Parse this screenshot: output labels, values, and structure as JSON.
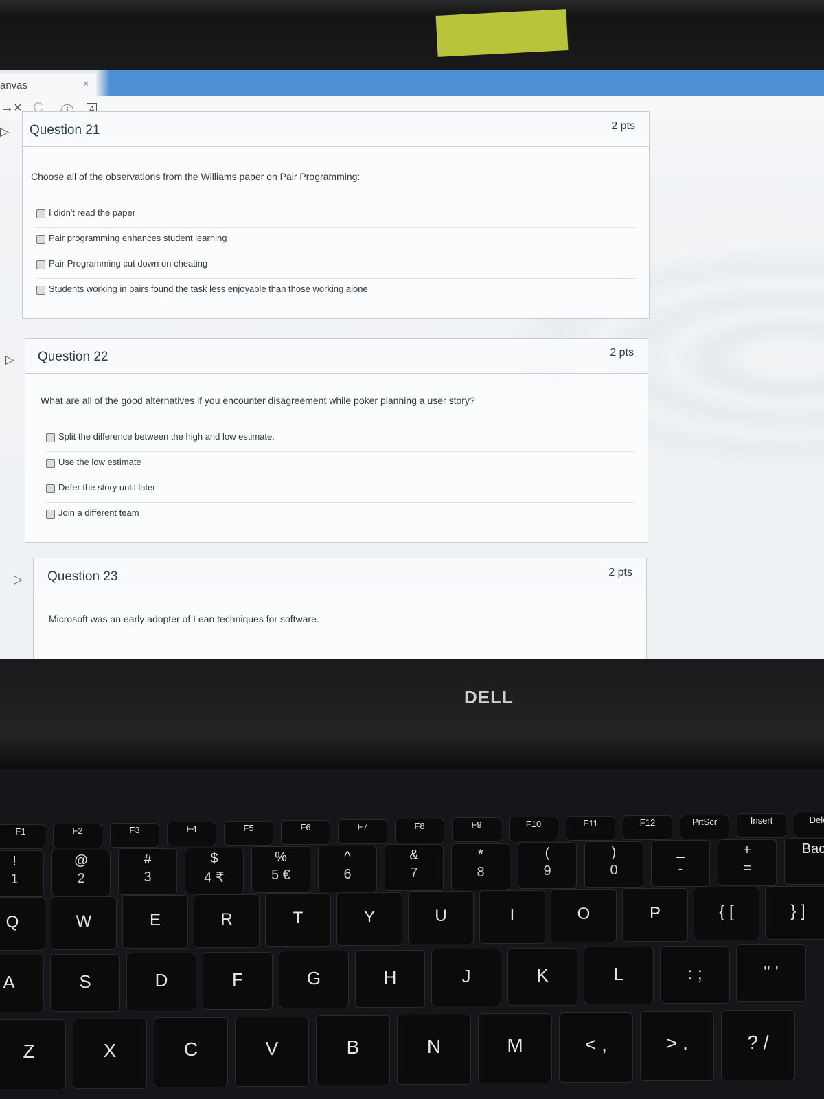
{
  "browser": {
    "tab_title": "anvas",
    "tab_close": "×",
    "nav": {
      "back_icon": "arrow-left",
      "stop_icon": "×",
      "reload_icon": "C",
      "info_icon": "ⓘ",
      "lock_icon": "A"
    }
  },
  "questions": [
    {
      "title": "Question 21",
      "points": "2 pts",
      "text": "Choose all of the observations from the Williams paper on Pair Programming:",
      "answers": [
        "I didn't read the paper",
        "Pair programming enhances student learning",
        "Pair Programming cut down on cheating",
        "Students working in pairs found the task less enjoyable than those working alone"
      ]
    },
    {
      "title": "Question 22",
      "points": "2 pts",
      "text": "What are all of the good alternatives if you encounter disagreement while poker planning a user story?",
      "answers": [
        "Split the difference between the high and low estimate.",
        "Use the low estimate",
        "Defer the story until later",
        "Join a different team"
      ]
    },
    {
      "title": "Question 23",
      "points": "2 pts",
      "text": "Microsoft was an early adopter of Lean techniques for software.",
      "answers": []
    }
  ],
  "laptop": {
    "brand": "DELL"
  },
  "keyboard": {
    "fn_row": [
      "F1",
      "F2",
      "F3",
      "F4",
      "F5",
      "F6",
      "F7",
      "F8",
      "F9",
      "F10",
      "F11",
      "F12",
      "PrtScr",
      "Insert",
      "Dele"
    ],
    "num_row": [
      {
        "main": "!",
        "sub": "1"
      },
      {
        "main": "@",
        "sub": "2"
      },
      {
        "main": "#",
        "sub": "3"
      },
      {
        "main": "$",
        "sub": "4 ₹"
      },
      {
        "main": "%",
        "sub": "5 €"
      },
      {
        "main": "^",
        "sub": "6"
      },
      {
        "main": "&",
        "sub": "7"
      },
      {
        "main": "*",
        "sub": "8"
      },
      {
        "main": "(",
        "sub": "9"
      },
      {
        "main": ")",
        "sub": "0"
      },
      {
        "main": "_",
        "sub": "-"
      },
      {
        "main": "+",
        "sub": "="
      },
      {
        "main": "Bac",
        "sub": ""
      }
    ],
    "row_q": [
      "Q",
      "W",
      "E",
      "R",
      "T",
      "Y",
      "U",
      "I",
      "O",
      "P",
      "{ [",
      "} ]"
    ],
    "row_a": [
      "A",
      "S",
      "D",
      "F",
      "G",
      "H",
      "J",
      "K",
      "L",
      ": ;",
      "\" '"
    ],
    "row_z": [
      "Z",
      "X",
      "C",
      "V",
      "B",
      "N",
      "M",
      "< ,",
      "> .",
      "? /"
    ]
  }
}
